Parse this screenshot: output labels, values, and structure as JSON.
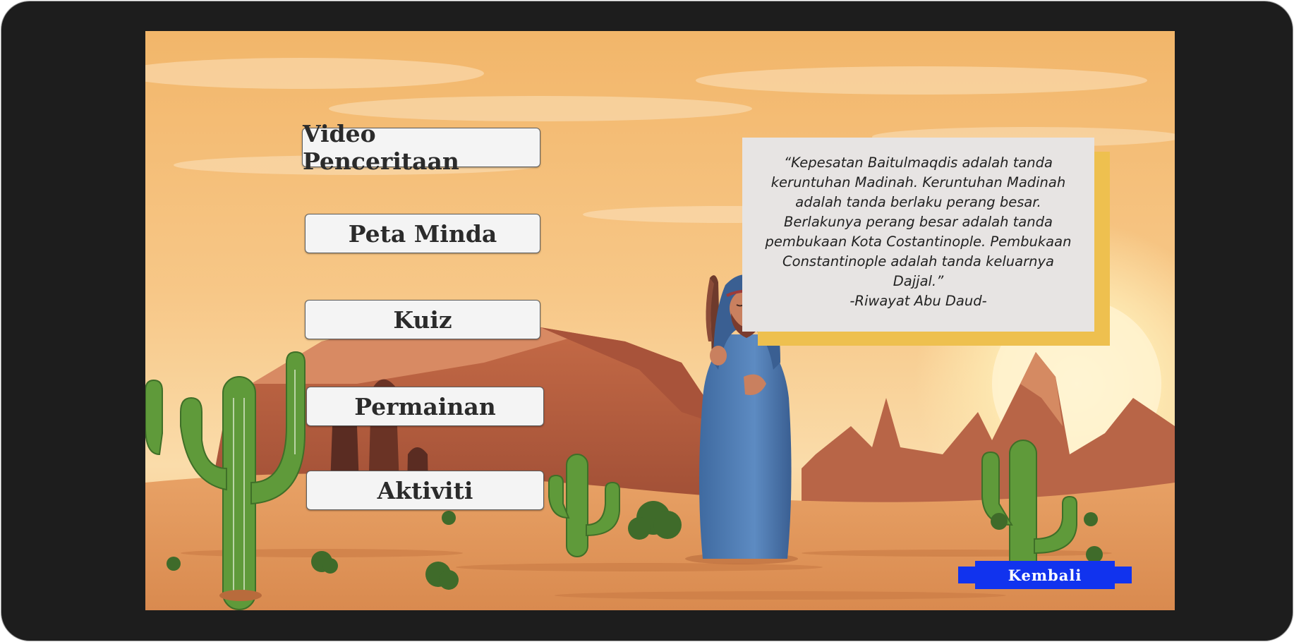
{
  "menu": {
    "video_label": "Video Penceritaan",
    "peta_label": "Peta Minda",
    "kuiz_label": "Kuiz",
    "permainan_label": "Permainan",
    "aktiviti_label": "Aktiviti"
  },
  "quote": {
    "lines": [
      "“Kepesatan Baitulmaqdis adalah tanda",
      "keruntuhan Madinah. Keruntuhan Madinah",
      "adalah tanda berlaku perang besar.",
      "Berlakunya perang besar adalah tanda",
      "pembukaan Kota Costantinople. Pembukaan",
      "Constantinople adalah tanda keluarnya",
      "Dajjal.”"
    ],
    "source": "-Riwayat Abu Daud-"
  },
  "back_button": {
    "label": "Kembali"
  },
  "colors": {
    "device_frame": "#1d1d1d",
    "button_bg": "#f4f4f4",
    "quote_bg": "#e7e4e3",
    "quote_accent": "#eec04f",
    "back_button_bg": "#1133ee"
  }
}
